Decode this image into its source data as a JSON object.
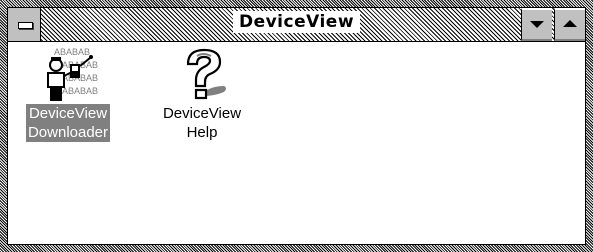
{
  "window": {
    "title": "DeviceView"
  },
  "icons": [
    {
      "line1": "DeviceView",
      "line2": "Downloader",
      "selected": true,
      "icon": "downloader-icon"
    },
    {
      "line1": "DeviceView",
      "line2": "Help",
      "selected": false,
      "icon": "help-question-icon"
    }
  ],
  "downloader_icon_text": "ABABAB"
}
